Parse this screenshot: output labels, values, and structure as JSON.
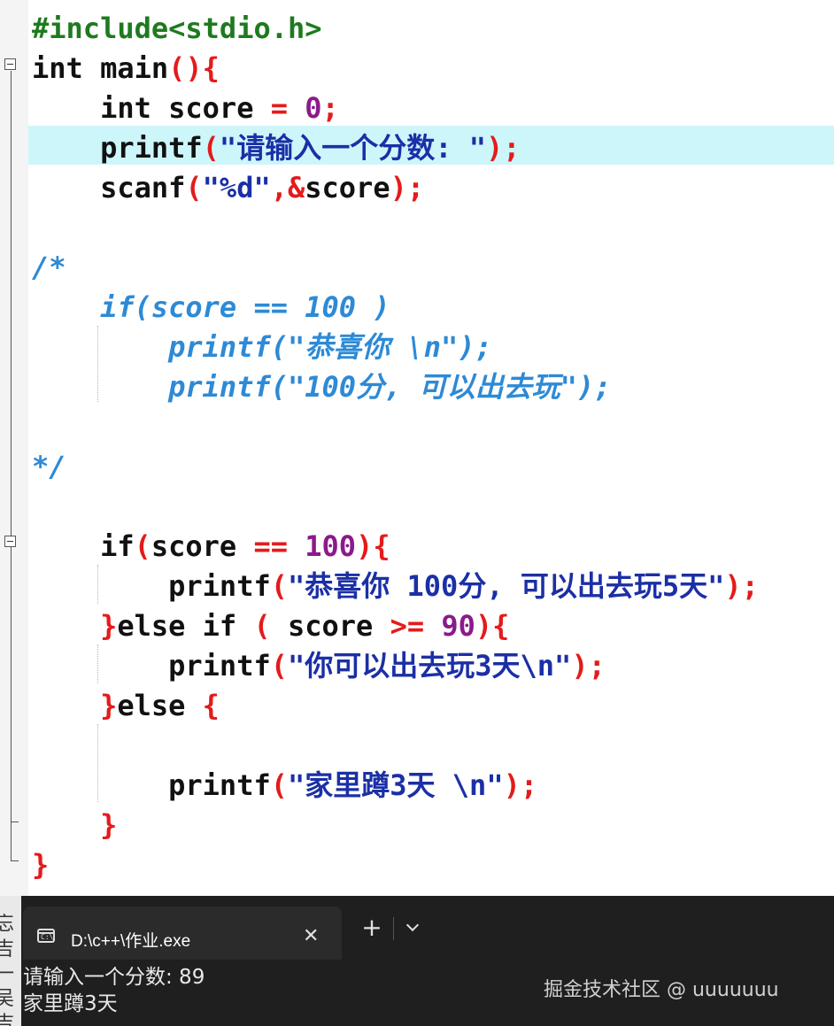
{
  "editor": {
    "lines": [
      {
        "id": "l1",
        "parts": [
          {
            "c": "pp",
            "t": "#include<stdio.h>"
          }
        ]
      },
      {
        "id": "l2",
        "parts": [
          {
            "c": "kw",
            "t": "int main"
          },
          {
            "c": "op",
            "t": "(){"
          }
        ]
      },
      {
        "id": "l3",
        "parts": [
          {
            "c": "kw",
            "t": "    int score "
          },
          {
            "c": "op",
            "t": "="
          },
          {
            "c": "kw",
            "t": " "
          },
          {
            "c": "num",
            "t": "0"
          },
          {
            "c": "op",
            "t": ";"
          }
        ]
      },
      {
        "id": "l4",
        "parts": [
          {
            "c": "kw",
            "t": "    printf"
          },
          {
            "c": "op",
            "t": "("
          },
          {
            "c": "str",
            "t": "\"请输入一个分数: \""
          },
          {
            "c": "op",
            "t": ");"
          }
        ]
      },
      {
        "id": "l5",
        "parts": [
          {
            "c": "kw",
            "t": "    scanf"
          },
          {
            "c": "op",
            "t": "("
          },
          {
            "c": "str",
            "t": "\"%d\""
          },
          {
            "c": "op",
            "t": ",&"
          },
          {
            "c": "kw",
            "t": "score"
          },
          {
            "c": "op",
            "t": ");"
          }
        ]
      },
      {
        "id": "l6",
        "parts": [
          {
            "c": "kw",
            "t": ""
          }
        ]
      },
      {
        "id": "l7",
        "parts": [
          {
            "c": "cm",
            "t": "/*"
          }
        ]
      },
      {
        "id": "l8",
        "parts": [
          {
            "c": "cm",
            "t": "    if(score == 100 )"
          }
        ]
      },
      {
        "id": "l9",
        "parts": [
          {
            "c": "cm",
            "t": "        printf(\"恭喜你 \\n\");"
          }
        ]
      },
      {
        "id": "l10",
        "parts": [
          {
            "c": "cm",
            "t": "        printf(\"100分, 可以出去玩\");"
          }
        ]
      },
      {
        "id": "l11",
        "parts": [
          {
            "c": "kw",
            "t": ""
          }
        ]
      },
      {
        "id": "l12",
        "parts": [
          {
            "c": "cm",
            "t": "*/"
          }
        ]
      },
      {
        "id": "l13",
        "parts": [
          {
            "c": "kw",
            "t": ""
          }
        ]
      },
      {
        "id": "l14",
        "parts": [
          {
            "c": "kw",
            "t": "    if"
          },
          {
            "c": "op",
            "t": "("
          },
          {
            "c": "kw",
            "t": "score "
          },
          {
            "c": "op",
            "t": "=="
          },
          {
            "c": "kw",
            "t": " "
          },
          {
            "c": "num",
            "t": "100"
          },
          {
            "c": "op",
            "t": "){"
          }
        ]
      },
      {
        "id": "l15",
        "parts": [
          {
            "c": "kw",
            "t": "        printf"
          },
          {
            "c": "op",
            "t": "("
          },
          {
            "c": "str",
            "t": "\"恭喜你 100分, 可以出去玩5天\""
          },
          {
            "c": "op",
            "t": ");"
          }
        ]
      },
      {
        "id": "l16",
        "parts": [
          {
            "c": "op",
            "t": "    }"
          },
          {
            "c": "kw",
            "t": "else if "
          },
          {
            "c": "op",
            "t": "("
          },
          {
            "c": "kw",
            "t": " score "
          },
          {
            "c": "op",
            "t": ">="
          },
          {
            "c": "kw",
            "t": " "
          },
          {
            "c": "num",
            "t": "90"
          },
          {
            "c": "op",
            "t": "){"
          }
        ]
      },
      {
        "id": "l17",
        "parts": [
          {
            "c": "kw",
            "t": "        printf"
          },
          {
            "c": "op",
            "t": "("
          },
          {
            "c": "str",
            "t": "\"你可以出去玩3天\\n\""
          },
          {
            "c": "op",
            "t": ");"
          }
        ]
      },
      {
        "id": "l18",
        "parts": [
          {
            "c": "op",
            "t": "    }"
          },
          {
            "c": "kw",
            "t": "else "
          },
          {
            "c": "op",
            "t": "{"
          }
        ]
      },
      {
        "id": "l19",
        "parts": [
          {
            "c": "kw",
            "t": ""
          }
        ]
      },
      {
        "id": "l20",
        "parts": [
          {
            "c": "kw",
            "t": "        printf"
          },
          {
            "c": "op",
            "t": "("
          },
          {
            "c": "str",
            "t": "\"家里蹲3天 \\n\""
          },
          {
            "c": "op",
            "t": ");"
          }
        ]
      },
      {
        "id": "l21",
        "parts": [
          {
            "c": "op",
            "t": "    }"
          }
        ]
      },
      {
        "id": "l22",
        "parts": [
          {
            "c": "op",
            "t": "}"
          }
        ]
      }
    ],
    "highlighted_line": 4
  },
  "terminal": {
    "tab_title": "D:\\c++\\作业.exe",
    "tab_icon": "console-app-icon",
    "close_icon": "close-icon",
    "new_tab_icon": "plus-icon",
    "dropdown_icon": "chevron-down-icon",
    "output": [
      "请输入一个分数: 89",
      "家里蹲3天"
    ],
    "edge_chars": [
      "忘",
      "吉",
      "一",
      "吴",
      "吉"
    ]
  },
  "watermark": "掘金技术社区 @ uuuuuuu",
  "colors": {
    "keyword": "#111111",
    "preprocessor": "#1f7a1f",
    "operator": "#e41b1b",
    "number": "#8b1a8b",
    "string": "#1b2fa6",
    "comment": "#2d8ad6",
    "line_highlight": "#cdf6fb",
    "terminal_bg": "#1f1f1f"
  }
}
